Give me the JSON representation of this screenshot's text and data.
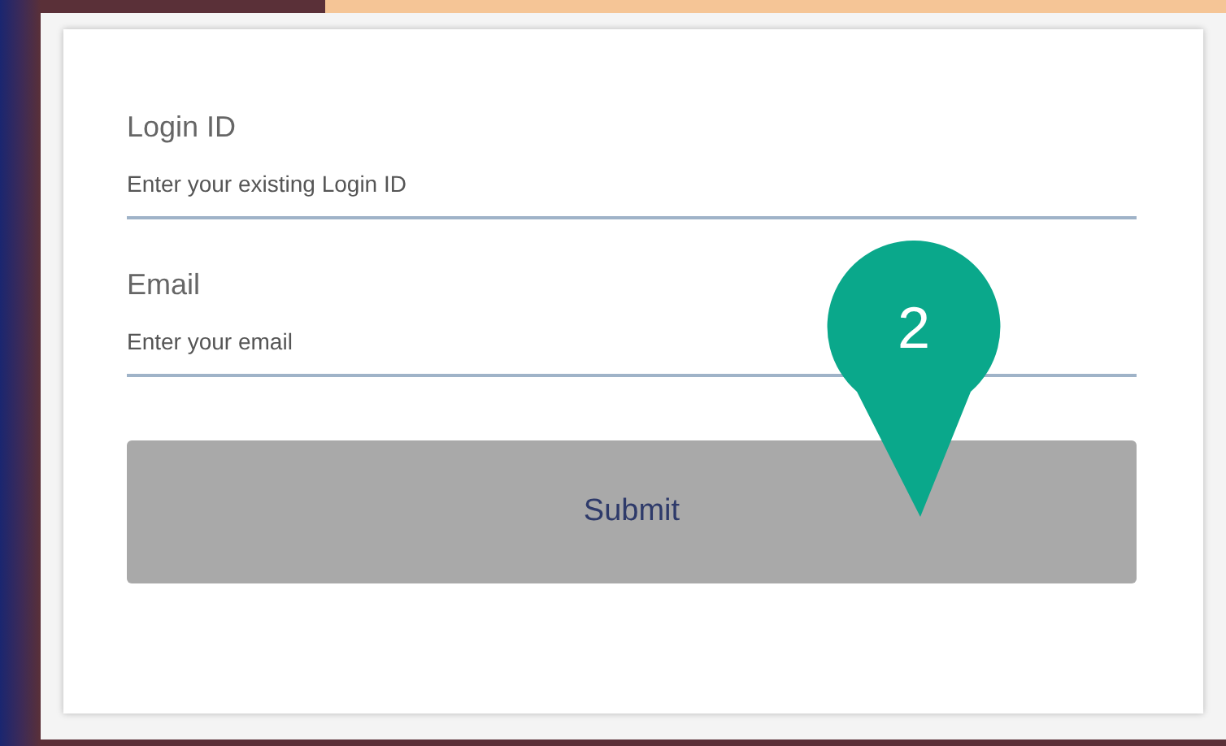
{
  "form": {
    "fields": [
      {
        "label": "Login ID",
        "placeholder": "Enter your existing Login ID"
      },
      {
        "label": "Email",
        "placeholder": "Enter your email"
      }
    ],
    "submit": "Submit"
  },
  "callout": {
    "number": "2"
  }
}
